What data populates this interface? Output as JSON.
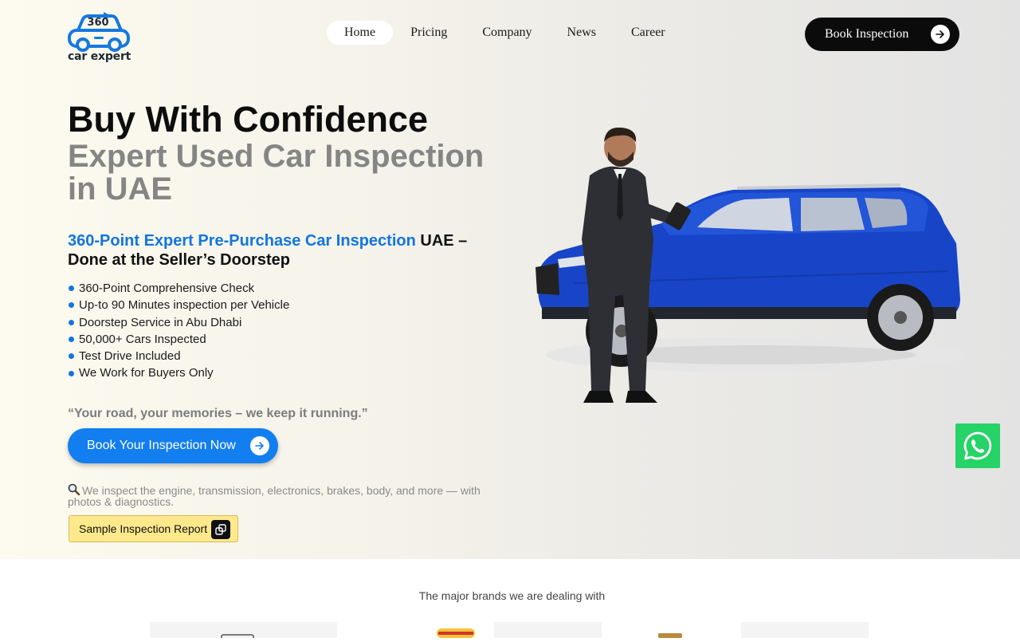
{
  "brand": {
    "logo_number": "360",
    "logo_text": "car expert"
  },
  "nav": {
    "items": [
      {
        "label": "Home",
        "active": true
      },
      {
        "label": "Pricing",
        "active": false
      },
      {
        "label": "Company",
        "active": false
      },
      {
        "label": "News",
        "active": false
      },
      {
        "label": "Career",
        "active": false
      }
    ],
    "book_button": "Book Inspection"
  },
  "hero": {
    "title": "Buy With Confidence",
    "subtitle": "Expert Used Car Inspection in UAE",
    "tagline_highlight": "360-Point Expert Pre-Purchase Car Inspection",
    "tagline_rest": " UAE – Done at the Seller’s Doorstep",
    "features": [
      "360-Point Comprehensive Check",
      "Up-to 90 Minutes inspection per Vehicle",
      "Doorstep Service in Abu Dhabi",
      "50,000+ Cars Inspected",
      "Test Drive Included",
      "We Work for Buyers Only"
    ],
    "quote": "“Your road, your memories – we keep it running.”",
    "cta_label": "Book Your Inspection Now",
    "note": "We inspect the engine, transmission, electronics, brakes, body, and more — with photos & diagnostics.",
    "report_button": "Sample Inspection Report"
  },
  "brands": {
    "title": "The major brands we are dealing with"
  },
  "colors": {
    "accent_blue": "#127ef0",
    "highlight_blue": "#1275e0",
    "dark": "#0b0b0b",
    "report_yellow": "#fde98c",
    "whatsapp_green": "#25d366"
  },
  "icons": {
    "logo": "car-icon",
    "book_arrow": "arrow-right-icon",
    "cta_arrow": "arrow-right-icon",
    "note": "magnifier-icon",
    "report": "external-link-icon",
    "whatsapp": "whatsapp-icon"
  }
}
